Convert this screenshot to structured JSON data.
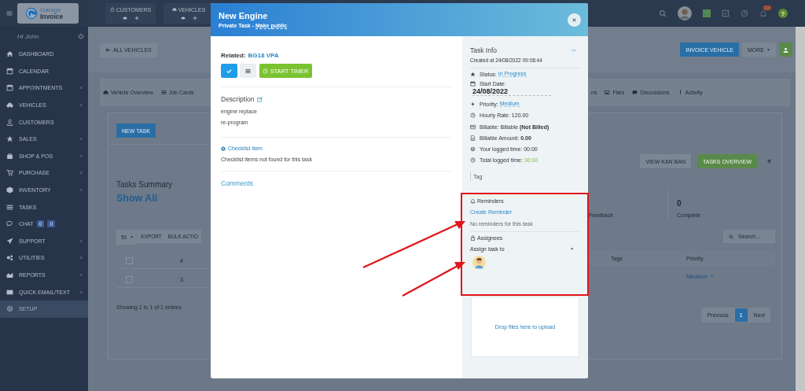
{
  "sidebar": {
    "logo": {
      "line1": "Garage",
      "line2": "Invoice"
    },
    "greeting": "Hi John",
    "items": [
      {
        "label": "DASHBOARD",
        "has_submenu": false,
        "selected": false
      },
      {
        "label": "CALENDAR",
        "has_submenu": false,
        "selected": false
      },
      {
        "label": "APPOINTMENTS",
        "has_submenu": true,
        "selected": false
      },
      {
        "label": "VEHICLES",
        "has_submenu": true,
        "selected": false
      },
      {
        "label": "CUSTOMERS",
        "has_submenu": false,
        "selected": false
      },
      {
        "label": "SALES",
        "has_submenu": true,
        "selected": false
      },
      {
        "label": "SHOP & POS",
        "has_submenu": true,
        "selected": false
      },
      {
        "label": "PURCHASE",
        "has_submenu": true,
        "selected": false
      },
      {
        "label": "INVENTORY",
        "has_submenu": true,
        "selected": false
      },
      {
        "label": "TASKS",
        "has_submenu": false,
        "selected": false
      },
      {
        "label": "CHAT",
        "has_submenu": false,
        "selected": false,
        "badges": [
          "0",
          "0"
        ]
      },
      {
        "label": "SUPPORT",
        "has_submenu": true,
        "selected": false
      },
      {
        "label": "UTILITIES",
        "has_submenu": true,
        "selected": false
      },
      {
        "label": "REPORTS",
        "has_submenu": true,
        "selected": false
      },
      {
        "label": "QUICK EMAIL/TEXT",
        "has_submenu": true,
        "selected": false
      },
      {
        "label": "SETUP",
        "has_submenu": false,
        "selected": true
      }
    ]
  },
  "topbar": {
    "shortcuts": [
      {
        "label": "CUSTOMERS"
      },
      {
        "label": "VEHICLES"
      }
    ],
    "help_label": "?"
  },
  "page": {
    "back_button": "ALL VEHICLES",
    "actions": [
      "INVOICE VEHICLE",
      "MORE"
    ],
    "tabs": [
      {
        "label": "Vehicle Overview"
      },
      {
        "label": "Job Cards"
      },
      {
        "label": "ns"
      },
      {
        "label": "Files"
      },
      {
        "label": "Discussions"
      },
      {
        "label": "Activity"
      }
    ],
    "new_task": "NEW TASK",
    "view_buttons": [
      {
        "label": "VIEW KAN BAN",
        "selected": false
      },
      {
        "label": "TASKS OVERVIEW",
        "selected": true
      }
    ],
    "summary": {
      "title": "Tasks Summary",
      "link": "Show All",
      "stats": [
        {
          "label": "Feedback"
        },
        {
          "value": "0",
          "label": "Complete"
        }
      ]
    },
    "table_tools": {
      "page_size": "50",
      "buttons": [
        "EXPORT",
        "BULK ACTIO"
      ],
      "search_placeholder": "Search..."
    },
    "table": {
      "select_all_checked": false,
      "columns": [
        "#",
        "Tags",
        "Priority"
      ],
      "rows": [
        {
          "checked": false,
          "number": "3",
          "priority": "Medium"
        }
      ]
    },
    "footer": "Showing 1 to 1 of 1 entries",
    "pagination": [
      {
        "label": "Previous",
        "selected": false
      },
      {
        "label": "1",
        "selected": true
      },
      {
        "label": "Next",
        "selected": false
      }
    ]
  },
  "modal": {
    "title": "New Engine",
    "subtitle": "Private Task - ",
    "subtitle_link": "Make public",
    "related_label": "Related:",
    "related_value": "BG18 VPA",
    "timer_button": "START TIMER",
    "description_title": "Description",
    "description_lines": [
      "engine replace",
      "re-program"
    ],
    "checklist_title": "Checklist Item",
    "checklist_empty": "Checklist items not found for this task",
    "comments_title": "Comments",
    "info": {
      "title": "Task Info",
      "created": "Created at 24/08/2022 09:08:44",
      "rows": [
        {
          "kind": "link",
          "label": "Status:",
          "value": "In Progress"
        },
        {
          "kind": "date",
          "label": "Start Date:",
          "value": "24/08/2022"
        },
        {
          "kind": "link",
          "label": "Priority:",
          "value": "Medium"
        },
        {
          "kind": "text",
          "label": "Hourly Rate: 120.00"
        },
        {
          "kind": "text",
          "label": "Billable: Billable **(Not Billed)**"
        },
        {
          "kind": "text",
          "label": "Billable Amount: **0.00**"
        },
        {
          "kind": "text",
          "label": "Your logged time: 00:00"
        },
        {
          "kind": "success",
          "label": "Total logged time:",
          "value": "00:00"
        }
      ],
      "tag_placeholder": "Tag"
    },
    "reminders": {
      "title": "Reminders",
      "create": "Create Reminder",
      "empty": "No reminders for this task"
    },
    "assignees": {
      "title": "Assignees",
      "placeholder": "Assign task to"
    },
    "dropzone": "Drop files here to upload"
  }
}
